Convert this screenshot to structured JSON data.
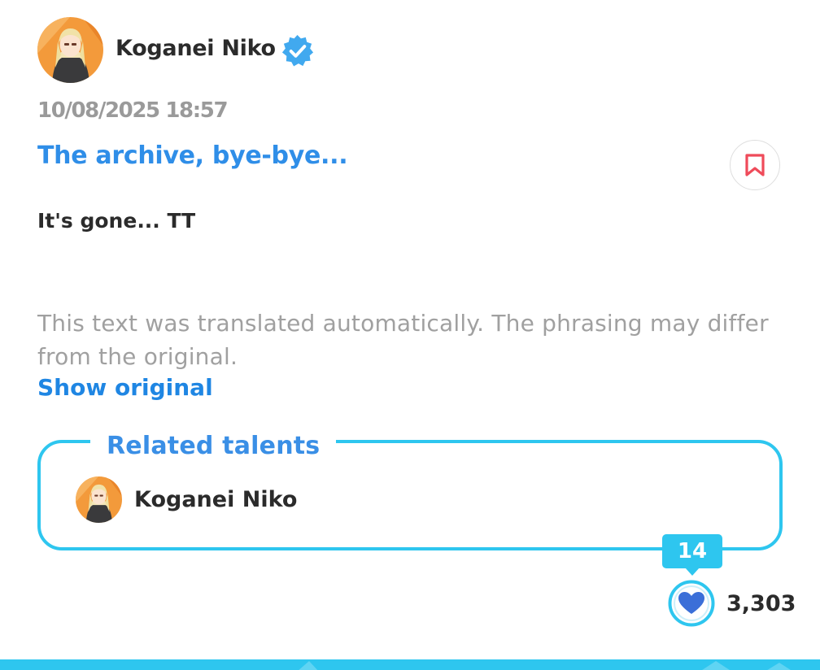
{
  "author": {
    "name": "Koganei Niko",
    "avatar_icon": "avatar-blonde-character",
    "verified_icon": "verified-badge-icon"
  },
  "post": {
    "timestamp": "10/08/2025 18:57",
    "title": "The archive, bye-bye...",
    "body": "It's gone... TT",
    "bookmark_icon": "bookmark-icon"
  },
  "translation": {
    "note": "This text was translated automatically. The phrasing may differ from the original.",
    "show_original_label": "Show original"
  },
  "related": {
    "title": "Related talents",
    "talents": [
      {
        "name": "Koganei Niko"
      }
    ]
  },
  "likes": {
    "bubble_count": "14",
    "total": "3,303",
    "heart_icon": "heart-icon"
  },
  "colors": {
    "accent_blue": "#2f8ee8",
    "link_blue": "#1f86e3",
    "cyan": "#2ec6ef",
    "bookmark_red": "#ef4b5a",
    "text_dark": "#2b2b2b",
    "text_muted": "#9a9a9a"
  }
}
